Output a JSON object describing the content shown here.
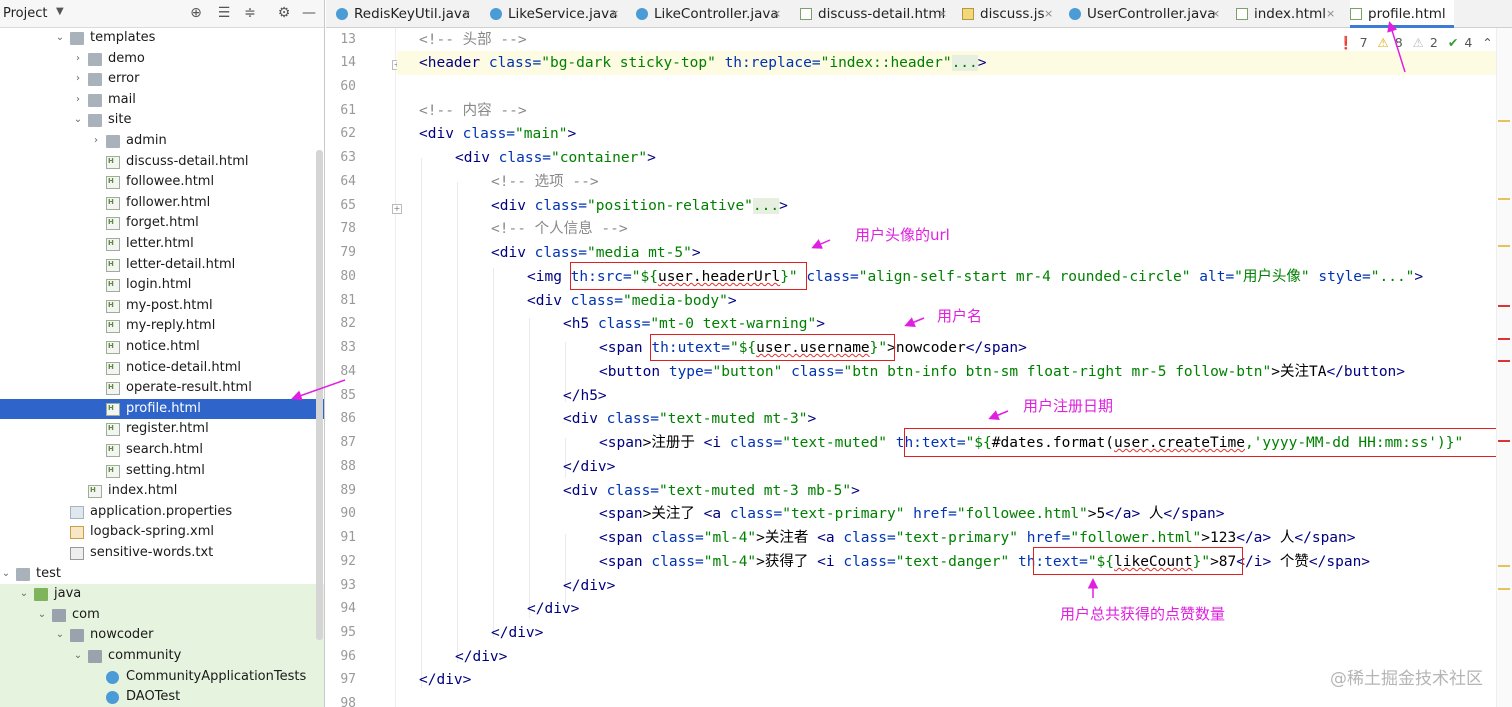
{
  "sidebar": {
    "title": "Project",
    "tree": [
      {
        "label": "templates",
        "kind": "folder",
        "depth": 3,
        "arrow": "open"
      },
      {
        "label": "demo",
        "kind": "folder",
        "depth": 4,
        "arrow": "closed"
      },
      {
        "label": "error",
        "kind": "folder",
        "depth": 4,
        "arrow": "closed"
      },
      {
        "label": "mail",
        "kind": "folder",
        "depth": 4,
        "arrow": "closed"
      },
      {
        "label": "site",
        "kind": "folder",
        "depth": 4,
        "arrow": "open"
      },
      {
        "label": "admin",
        "kind": "folder",
        "depth": 5,
        "arrow": "closed"
      },
      {
        "label": "discuss-detail.html",
        "kind": "html",
        "depth": 5
      },
      {
        "label": "followee.html",
        "kind": "html",
        "depth": 5
      },
      {
        "label": "follower.html",
        "kind": "html",
        "depth": 5
      },
      {
        "label": "forget.html",
        "kind": "html",
        "depth": 5
      },
      {
        "label": "letter.html",
        "kind": "html",
        "depth": 5
      },
      {
        "label": "letter-detail.html",
        "kind": "html",
        "depth": 5
      },
      {
        "label": "login.html",
        "kind": "html",
        "depth": 5
      },
      {
        "label": "my-post.html",
        "kind": "html",
        "depth": 5
      },
      {
        "label": "my-reply.html",
        "kind": "html",
        "depth": 5
      },
      {
        "label": "notice.html",
        "kind": "html",
        "depth": 5
      },
      {
        "label": "notice-detail.html",
        "kind": "html",
        "depth": 5
      },
      {
        "label": "operate-result.html",
        "kind": "html",
        "depth": 5
      },
      {
        "label": "profile.html",
        "kind": "html",
        "depth": 5,
        "selected": true
      },
      {
        "label": "register.html",
        "kind": "html",
        "depth": 5
      },
      {
        "label": "search.html",
        "kind": "html",
        "depth": 5
      },
      {
        "label": "setting.html",
        "kind": "html",
        "depth": 5
      },
      {
        "label": "index.html",
        "kind": "html",
        "depth": 4
      },
      {
        "label": "application.properties",
        "kind": "prop",
        "depth": 3
      },
      {
        "label": "logback-spring.xml",
        "kind": "xml",
        "depth": 3
      },
      {
        "label": "sensitive-words.txt",
        "kind": "txt",
        "depth": 3
      },
      {
        "label": "test",
        "kind": "folder",
        "depth": 0,
        "arrow": "open"
      },
      {
        "label": "java",
        "kind": "src",
        "depth": 1,
        "arrow": "open",
        "green": true
      },
      {
        "label": "com",
        "kind": "pkg",
        "depth": 2,
        "arrow": "open",
        "green": true
      },
      {
        "label": "nowcoder",
        "kind": "pkg",
        "depth": 3,
        "arrow": "open",
        "green": true
      },
      {
        "label": "community",
        "kind": "pkg",
        "depth": 4,
        "arrow": "open",
        "green": true
      },
      {
        "label": "CommunityApplicationTests",
        "kind": "java",
        "depth": 5,
        "green": true
      },
      {
        "label": "DAOTest",
        "kind": "java",
        "depth": 5,
        "green": true
      }
    ]
  },
  "tabs": [
    {
      "label": "RedisKeyUtil.java",
      "kind": "java"
    },
    {
      "label": "LikeService.java",
      "kind": "java"
    },
    {
      "label": "LikeController.java",
      "kind": "java"
    },
    {
      "label": "discuss-detail.html",
      "kind": "html"
    },
    {
      "label": "discuss.js",
      "kind": "js"
    },
    {
      "label": "UserController.java",
      "kind": "java"
    },
    {
      "label": "index.html",
      "kind": "html"
    },
    {
      "label": "profile.html",
      "kind": "html",
      "active": true
    }
  ],
  "inspections": {
    "errors": "7",
    "warnings": "8",
    "weak": "2",
    "typos": "4"
  },
  "line_numbers": [
    "13",
    "14",
    "60",
    "61",
    "62",
    "63",
    "64",
    "65",
    "78",
    "79",
    "80",
    "81",
    "82",
    "83",
    "84",
    "85",
    "86",
    "87",
    "88",
    "89",
    "90",
    "91",
    "92",
    "93",
    "94",
    "95",
    "96",
    "97",
    "98"
  ],
  "code": {
    "l13": "<!-- 头部 -->",
    "l14_open": "<header",
    "l14_a1": "class=",
    "l14_v1": "\"bg-dark sticky-top\"",
    "l14_a2": "th:replace=",
    "l14_v2": "\"index::header\"",
    "l14_fold": "...",
    "l14_close": ">",
    "l61": "<!-- 内容 -->",
    "l62_open": "<div",
    "l62_a": "class=",
    "l62_v": "\"main\"",
    "l62_close": ">",
    "l63_open": "<div",
    "l63_a": "class=",
    "l63_v": "\"container\"",
    "l63_close": ">",
    "l64": "<!-- 选项 -->",
    "l65_open": "<div",
    "l65_a": "class=",
    "l65_v": "\"position-relative\"",
    "l65_fold": "...",
    "l65_close": ">",
    "l78": "<!-- 个人信息 -->",
    "l79_open": "<div",
    "l79_a": "class=",
    "l79_v": "\"media mt-5\"",
    "l79_close": ">",
    "l80_open": "<img",
    "l80_a1": "th:src=",
    "l80_v1a": "\"${",
    "l80_v1b": "user.headerUrl",
    "l80_v1c": "}\"",
    "l80_a2": "class=",
    "l80_v2": "\"align-self-start mr-4 rounded-circle\"",
    "l80_a3": "alt=",
    "l80_v3": "\"用户头像\"",
    "l80_a4": "style=",
    "l80_v4": "\"...\"",
    "l80_close": ">",
    "l81_open": "<div",
    "l81_a": "class=",
    "l81_v": "\"media-body\"",
    "l81_close": ">",
    "l82_open": "<h5",
    "l82_a": "class=",
    "l82_v": "\"mt-0 text-warning\"",
    "l82_close": ">",
    "l83_open": "<span",
    "l83_a": "th:utext=",
    "l83_v1": "\"${",
    "l83_v2": "user.username",
    "l83_v3": "}\"",
    "l83_text": ">nowcoder",
    "l83_close": "</span>",
    "l84_open": "<button",
    "l84_a1": "type=",
    "l84_v1": "\"button\"",
    "l84_a2": "class=",
    "l84_v2": "\"btn btn-info btn-sm float-right mr-5 follow-btn\"",
    "l84_text": ">关注TA",
    "l84_close": "</button>",
    "l85": "</h5>",
    "l86_open": "<div",
    "l86_a": "class=",
    "l86_v": "\"text-muted mt-3\"",
    "l86_close": ">",
    "l87_open": "<span",
    "l87_text": ">注册于 ",
    "l87_i": "<i",
    "l87_a1": "class=",
    "l87_v1": "\"text-muted\"",
    "l87_a2": "th:text=",
    "l87_v2": "\"${",
    "l87_v3": "#dates.format(",
    "l87_v4": "user.createTime",
    "l87_v5": ",'yyyy-MM-dd HH:mm:ss')}\"",
    "l88": "</div>",
    "l89_open": "<div",
    "l89_a": "class=",
    "l89_v": "\"text-muted mt-3 mb-5\"",
    "l89_close": ">",
    "l90_open": "<span",
    "l90_text": ">关注了 ",
    "l90_a_open": "<a",
    "l90_a1": "class=",
    "l90_v1": "\"text-primary\"",
    "l90_a2": "href=",
    "l90_v2": "\"followee.html\"",
    "l90_text2": ">5",
    "l90_a_close": "</a>",
    "l90_text3": " 人",
    "l90_close": "</span>",
    "l91_open": "<span",
    "l91_a1": "class=",
    "l91_v1": "\"ml-4\"",
    "l91_text": ">关注者 ",
    "l91_a_open": "<a",
    "l91_a2": "class=",
    "l91_v2": "\"text-primary\"",
    "l91_a3": "href=",
    "l91_v3": "\"follower.html\"",
    "l91_text2": ">123",
    "l91_a_close": "</a>",
    "l91_text3": " 人",
    "l91_close": "</span>",
    "l92_open": "<span",
    "l92_a1": "class=",
    "l92_v1": "\"ml-4\"",
    "l92_text": ">获得了 ",
    "l92_i": "<i",
    "l92_a2": "class=",
    "l92_v2": "\"text-danger\"",
    "l92_a3": "th:text=",
    "l92_v3": "\"${",
    "l92_v4": "likeCount",
    "l92_v5": "}\"",
    "l92_text2": ">87",
    "l92_i_close": "</i>",
    "l92_text3": " 个赞",
    "l92_close": "</span>",
    "l93": "</div>",
    "l94": "</div>",
    "l95": "</div>",
    "l96": "</div>",
    "l97": "</div>"
  },
  "annotations": {
    "avatar": "用户头像的url",
    "username": "用户名",
    "register_date": "用户注册日期",
    "like_count": "用户总共获得的点赞数量"
  },
  "colors": {
    "annotation": "#e020e0",
    "box": "#e02020",
    "selection": "#2f65ca"
  },
  "watermark": "@稀土掘金技术社区"
}
